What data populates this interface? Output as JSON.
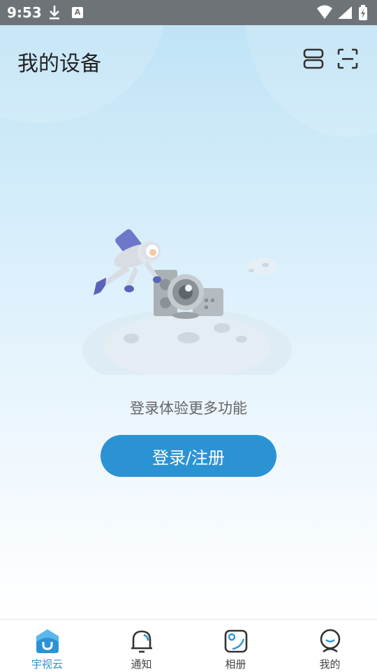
{
  "status_bar": {
    "time": "9:53",
    "icons": [
      "download-icon",
      "a-box-icon",
      "wifi-icon",
      "signal-icon",
      "battery-icon"
    ]
  },
  "header": {
    "title": "我的设备",
    "icons": [
      "list-view-icon",
      "scan-icon"
    ]
  },
  "empty_state": {
    "illustration": "astronaut-camera-moon-illustration",
    "prompt": "登录体验更多功能",
    "login_button": "登录/注册"
  },
  "tabbar": {
    "active_color": "#2b93d4",
    "tabs": [
      {
        "label": "宇视云",
        "icon": "cloud-home-icon",
        "active": true
      },
      {
        "label": "通知",
        "icon": "bell-icon",
        "active": false
      },
      {
        "label": "相册",
        "icon": "album-icon",
        "active": false
      },
      {
        "label": "我的",
        "icon": "profile-icon",
        "active": false
      }
    ]
  }
}
